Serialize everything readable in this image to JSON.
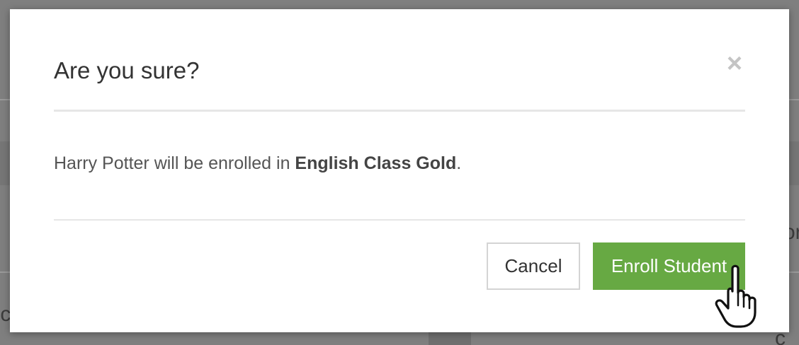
{
  "modal": {
    "title": "Are you sure?",
    "close_symbol": "×",
    "body": {
      "student_name_prefix": "Harry Potter will be enrolled in ",
      "class_name": "English Class Gold",
      "suffix": "."
    },
    "buttons": {
      "cancel_label": "Cancel",
      "enroll_label": "Enroll Student"
    }
  },
  "background": {
    "visible_fragments": [
      "or",
      "r c",
      "d c"
    ]
  },
  "colors": {
    "overlay": "#7f7f7f",
    "primary_green": "#67a943",
    "title_text": "#333333",
    "body_text": "#555555"
  },
  "icons": {
    "close": "close-icon",
    "pointer": "hand-pointer-cursor-icon"
  }
}
